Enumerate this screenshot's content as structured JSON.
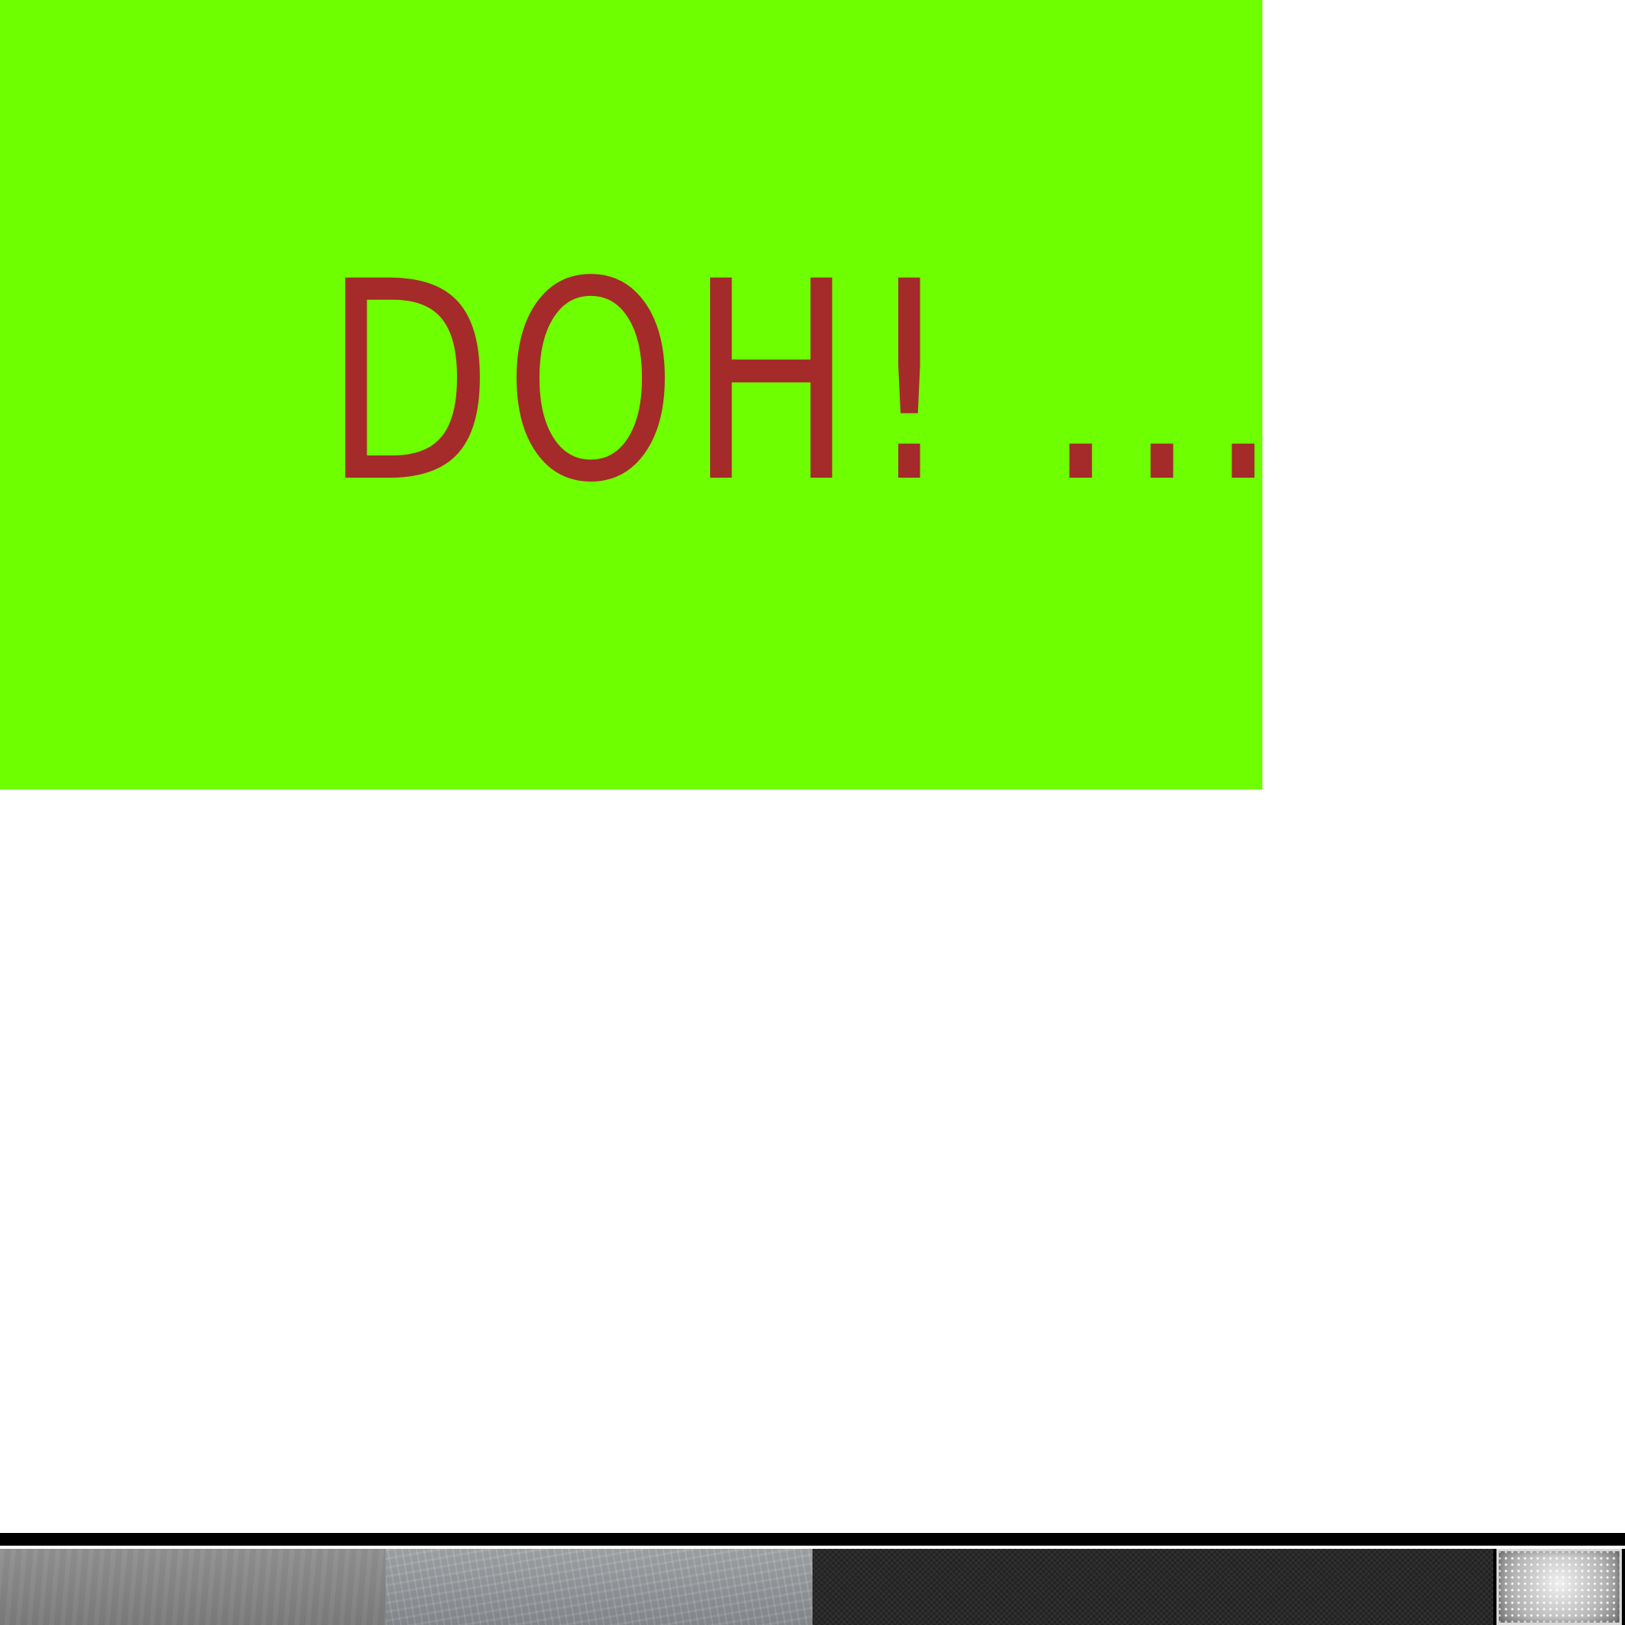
{
  "banner": {
    "text": "DOH! ...",
    "background_color": "#6eff00",
    "text_color": "#a52a2a"
  },
  "strip": {
    "swatches": [
      "brushed-gray",
      "scratched-steel",
      "dark-textured",
      "hammered-metal-tile"
    ]
  }
}
